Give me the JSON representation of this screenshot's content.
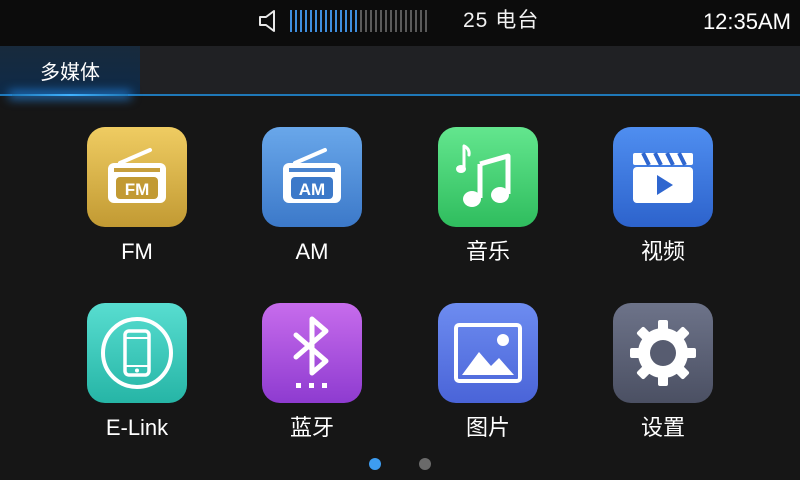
{
  "status": {
    "volume_level": 0.5,
    "volume_ticks": 28,
    "station": "25 电台",
    "clock": "12:35AM",
    "colors": {
      "volume_active": "#3e8fe0",
      "volume_inactive": "#5a5a5a"
    }
  },
  "tabs": [
    {
      "label": "多媒体",
      "active": true
    }
  ],
  "apps": [
    {
      "label": "FM",
      "icon": "fm-radio-icon",
      "badge": "FM"
    },
    {
      "label": "AM",
      "icon": "am-radio-icon",
      "badge": "AM"
    },
    {
      "label": "音乐",
      "icon": "music-note-icon"
    },
    {
      "label": "视频",
      "icon": "video-clapper-icon"
    },
    {
      "label": "E-Link",
      "icon": "phone-link-icon"
    },
    {
      "label": "蓝牙",
      "icon": "bluetooth-icon"
    },
    {
      "label": "图片",
      "icon": "picture-icon"
    },
    {
      "label": "设置",
      "icon": "gear-icon"
    }
  ],
  "pager": {
    "pages": 2,
    "current": 1,
    "colors": {
      "active": "#3d9cf0",
      "inactive": "#6a6a6a"
    }
  }
}
